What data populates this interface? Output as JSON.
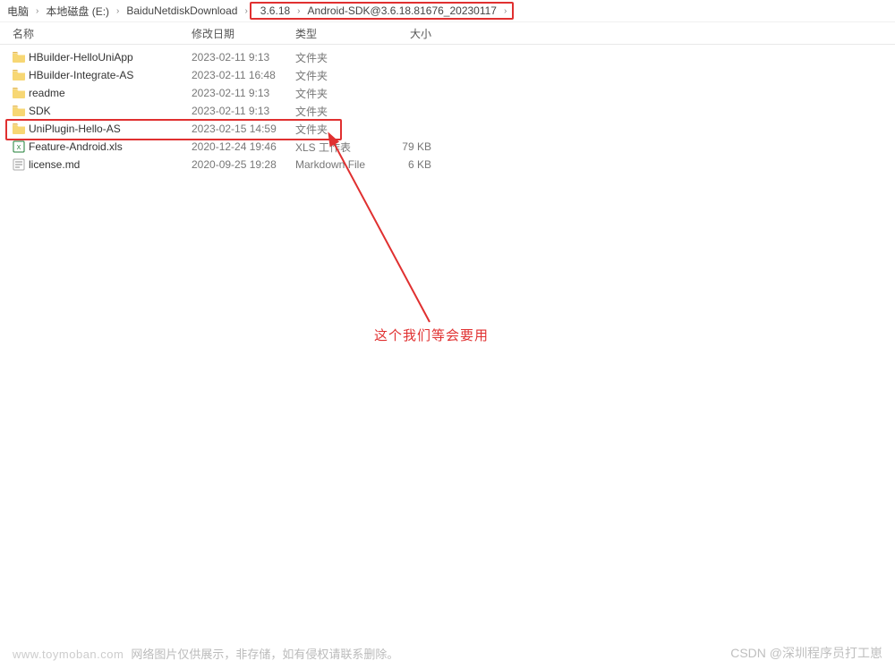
{
  "breadcrumb": {
    "root": "电脑",
    "drive": "本地磁盘 (E:)",
    "folder1": "BaiduNetdiskDownload",
    "folder2": "3.6.18",
    "folder3": "Android-SDK@3.6.18.81676_20230117"
  },
  "columns": {
    "name": "名称",
    "date": "修改日期",
    "type": "类型",
    "size": "大小"
  },
  "files": [
    {
      "icon": "folder",
      "name": "HBuilder-HelloUniApp",
      "date": "2023-02-11 9:13",
      "type": "文件夹",
      "size": "",
      "highlight": false
    },
    {
      "icon": "folder",
      "name": "HBuilder-Integrate-AS",
      "date": "2023-02-11 16:48",
      "type": "文件夹",
      "size": "",
      "highlight": false
    },
    {
      "icon": "folder",
      "name": "readme",
      "date": "2023-02-11 9:13",
      "type": "文件夹",
      "size": "",
      "highlight": false
    },
    {
      "icon": "folder",
      "name": "SDK",
      "date": "2023-02-11 9:13",
      "type": "文件夹",
      "size": "",
      "highlight": false
    },
    {
      "icon": "folder",
      "name": "UniPlugin-Hello-AS",
      "date": "2023-02-15 14:59",
      "type": "文件夹",
      "size": "",
      "highlight": true
    },
    {
      "icon": "xls",
      "name": "Feature-Android.xls",
      "date": "2020-12-24 19:46",
      "type": "XLS 工作表",
      "size": "79 KB",
      "highlight": false
    },
    {
      "icon": "md",
      "name": "license.md",
      "date": "2020-09-25 19:28",
      "type": "Markdown File",
      "size": "6 KB",
      "highlight": false
    }
  ],
  "annotation": {
    "text": "这个我们等会要用"
  },
  "footer": {
    "domain": "www.toymoban.com",
    "text": "网络图片仅供展示，非存储，如有侵权请联系删除。"
  },
  "watermark": "CSDN @深圳程序员打工崽"
}
